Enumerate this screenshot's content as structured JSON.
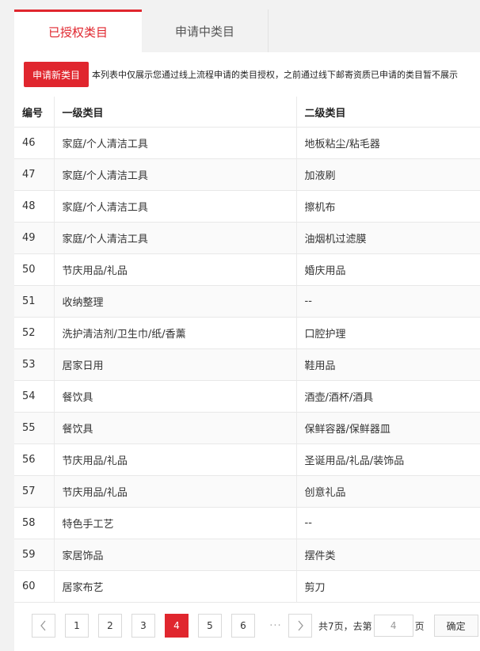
{
  "tabs": [
    {
      "label": "已授权类目",
      "active": true
    },
    {
      "label": "申请中类目",
      "active": false
    }
  ],
  "toolbar": {
    "apply_label": "申请新类目",
    "notice": "本列表中仅展示您通过线上流程申请的类目授权，之前通过线下邮寄资质已申请的类目暂不展示"
  },
  "table": {
    "headers": [
      "编号",
      "一级类目",
      "二级类目"
    ],
    "rows": [
      [
        "46",
        "家庭/个人清洁工具",
        "地板粘尘/粘毛器"
      ],
      [
        "47",
        "家庭/个人清洁工具",
        "加液刷"
      ],
      [
        "48",
        "家庭/个人清洁工具",
        "擦机布"
      ],
      [
        "49",
        "家庭/个人清洁工具",
        "油烟机过滤膜"
      ],
      [
        "50",
        "节庆用品/礼品",
        "婚庆用品"
      ],
      [
        "51",
        "收纳整理",
        "--"
      ],
      [
        "52",
        "洗护清洁剂/卫生巾/纸/香薰",
        "口腔护理"
      ],
      [
        "53",
        "居家日用",
        "鞋用品"
      ],
      [
        "54",
        "餐饮具",
        "酒壶/酒杯/酒具"
      ],
      [
        "55",
        "餐饮具",
        "保鲜容器/保鲜器皿"
      ],
      [
        "56",
        "节庆用品/礼品",
        "圣诞用品/礼品/装饰品"
      ],
      [
        "57",
        "节庆用品/礼品",
        "创意礼品"
      ],
      [
        "58",
        "特色手工艺",
        "--"
      ],
      [
        "59",
        "家居饰品",
        "摆件类"
      ],
      [
        "60",
        "居家布艺",
        "剪刀"
      ]
    ]
  },
  "pagination": {
    "prev_icon": "chevron-left-icon",
    "next_icon": "chevron-right-icon",
    "pages": [
      "1",
      "2",
      "3",
      "4",
      "5",
      "6"
    ],
    "current": "4",
    "ellipsis": "···",
    "total_text": "共7页，去第",
    "input_value": "4",
    "unit": "页",
    "confirm_label": "确定"
  },
  "colors": {
    "accent": "#e0262e"
  }
}
